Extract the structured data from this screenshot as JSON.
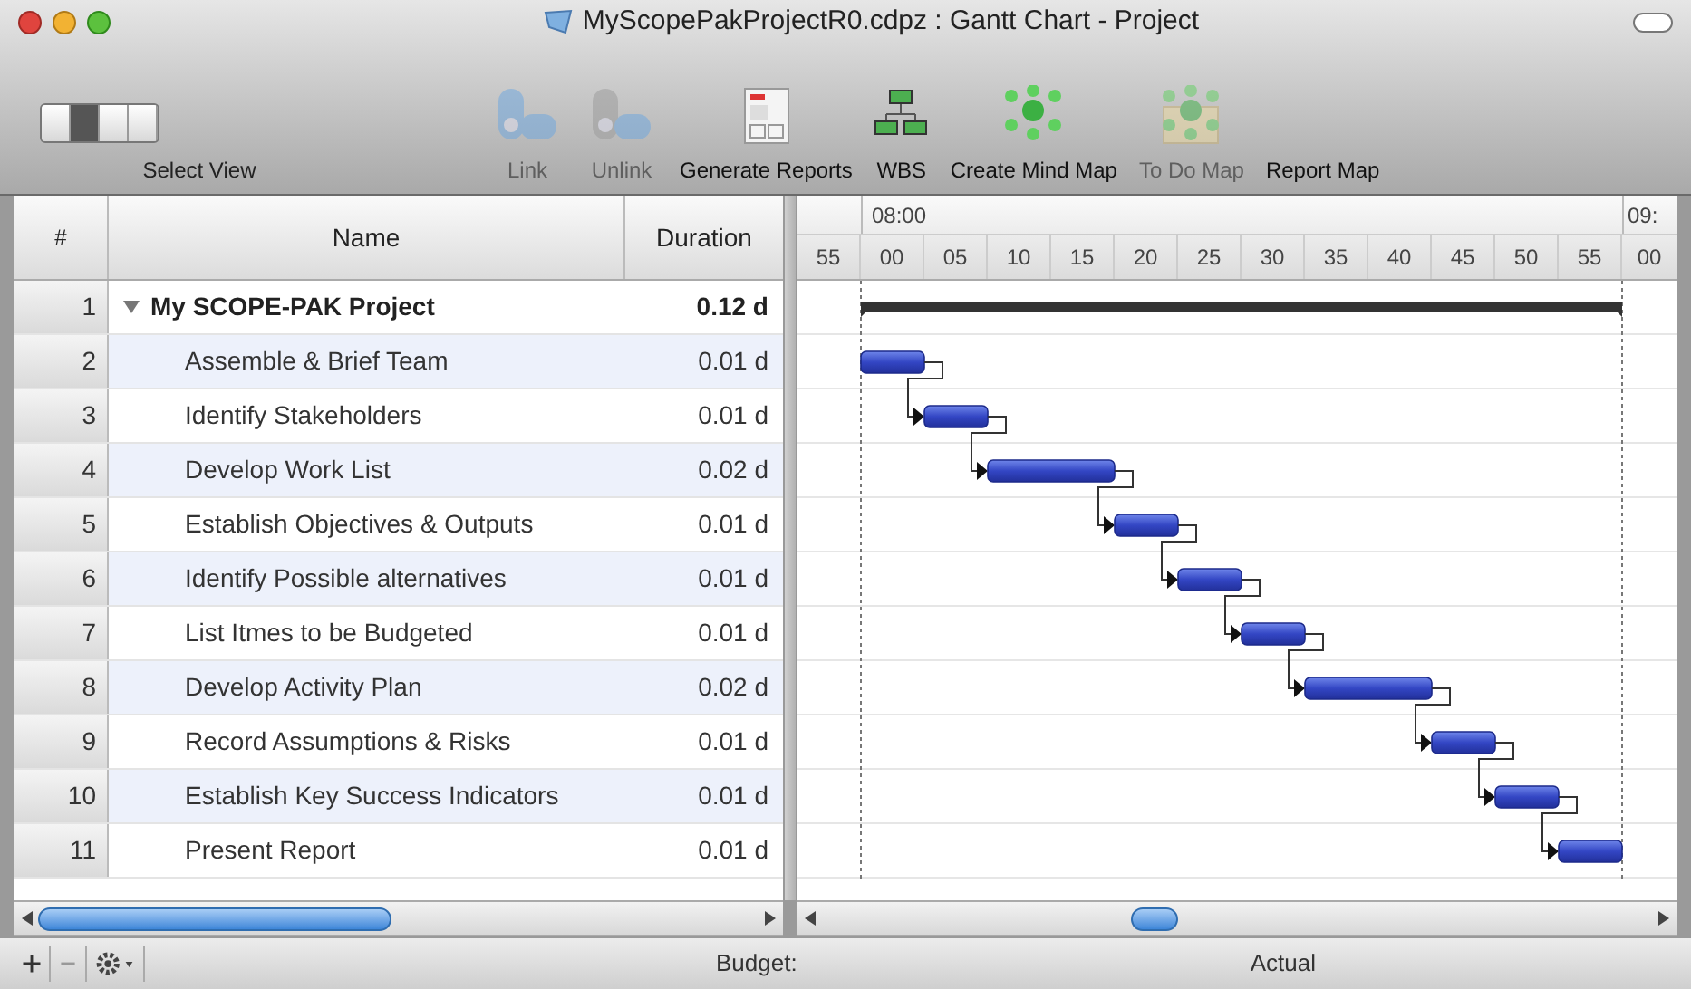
{
  "window": {
    "title": "MyScopePakProjectR0.cdpz : Gantt Chart - Project"
  },
  "toolbar": {
    "view_selector": {
      "label": "Select View",
      "segments": [
        {
          "selected": false
        },
        {
          "selected": true
        },
        {
          "selected": false
        },
        {
          "selected": false
        }
      ]
    },
    "items": [
      {
        "kind": "link",
        "label": "Link",
        "disabled": true
      },
      {
        "kind": "unlink",
        "label": "Unlink",
        "disabled": true
      },
      {
        "kind": "reports",
        "label": "Generate Reports",
        "disabled": false
      },
      {
        "kind": "wbs",
        "label": "WBS",
        "disabled": false
      },
      {
        "kind": "mindmap",
        "label": "Create Mind Map",
        "disabled": false
      },
      {
        "kind": "todo",
        "label": "To Do Map",
        "disabled": true
      },
      {
        "kind": "reportmap",
        "label": "Report Map",
        "disabled": false
      }
    ]
  },
  "table": {
    "columns": [
      "#",
      "Name",
      "Duration"
    ],
    "rows": [
      {
        "number": "1",
        "name": "My SCOPE-PAK Project",
        "duration": "0.12 d",
        "expanded": true,
        "children": [
          {
            "number": "2",
            "name": "Assemble & Brief Team",
            "duration": "0.01 d"
          },
          {
            "number": "3",
            "name": "Identify Stakeholders",
            "duration": "0.01 d"
          },
          {
            "number": "4",
            "name": "Develop Work List",
            "duration": "0.02 d"
          },
          {
            "number": "5",
            "name": "Establish Objectives & Outputs",
            "duration": "0.01 d"
          },
          {
            "number": "6",
            "name": "Identify Possible alternatives",
            "duration": "0.01 d"
          },
          {
            "number": "7",
            "name": "List Itmes to be Budgeted",
            "duration": "0.01 d"
          },
          {
            "number": "8",
            "name": "Develop Activity Plan",
            "duration": "0.02 d"
          },
          {
            "number": "9",
            "name": "Record Assumptions & Risks",
            "duration": "0.01 d"
          },
          {
            "number": "10",
            "name": "Establish Key Success Indicators",
            "duration": "0.01 d"
          },
          {
            "number": "11",
            "name": "Present Report",
            "duration": "0.01 d"
          }
        ]
      }
    ]
  },
  "timeline": {
    "hours": [
      "08:00",
      "09:"
    ],
    "minutes": [
      "55",
      "00",
      "05",
      "10",
      "15",
      "20",
      "25",
      "30",
      "35",
      "40",
      "45",
      "50",
      "55",
      "00"
    ]
  },
  "status_bar": {
    "budget_label": "Budget:",
    "actual_label": "Actual"
  }
}
